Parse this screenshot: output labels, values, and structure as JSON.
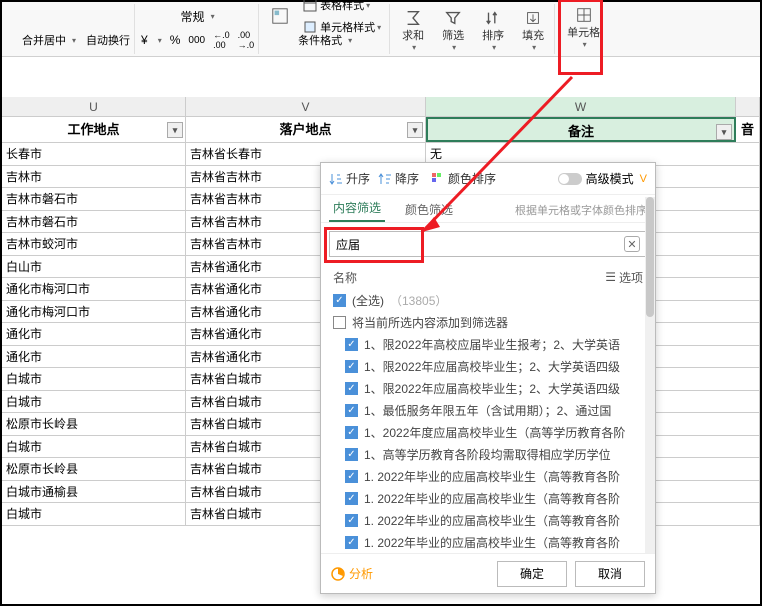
{
  "toolbar": {
    "merge_center": "合并居中",
    "wrap_text": "自动换行",
    "format_general": "常规",
    "currency": "¥",
    "percent": "%",
    "thousands": "000",
    "dec_inc": "←0.00",
    "dec_dec": ".00→0",
    "cond_format": "条件格式",
    "table_style": "表格样式",
    "cell_style": "单元格样式",
    "sum": "求和",
    "filter": "筛选",
    "sort": "排序",
    "fill": "填充",
    "cell": "单元格"
  },
  "columns": {
    "u": "U",
    "v": "V",
    "w": "W"
  },
  "headers": {
    "u": "工作地点",
    "v": "落户地点",
    "w": "备注",
    "end": "音"
  },
  "last_col_value": "无",
  "rows": [
    {
      "u": "长春市",
      "v": "吉林省长春市"
    },
    {
      "u": "吉林市",
      "v": "吉林省吉林市"
    },
    {
      "u": "吉林市磐石市",
      "v": "吉林省吉林市"
    },
    {
      "u": "吉林市磐石市",
      "v": "吉林省吉林市"
    },
    {
      "u": "吉林市蛟河市",
      "v": "吉林省吉林市"
    },
    {
      "u": "白山市",
      "v": "吉林省通化市"
    },
    {
      "u": "通化市梅河口市",
      "v": "吉林省通化市"
    },
    {
      "u": "通化市梅河口市",
      "v": "吉林省通化市"
    },
    {
      "u": "通化市",
      "v": "吉林省通化市"
    },
    {
      "u": "通化市",
      "v": "吉林省通化市"
    },
    {
      "u": "白城市",
      "v": "吉林省白城市"
    },
    {
      "u": "白城市",
      "v": "吉林省白城市"
    },
    {
      "u": "松原市长岭县",
      "v": "吉林省白城市"
    },
    {
      "u": "白城市",
      "v": "吉林省白城市"
    },
    {
      "u": "松原市长岭县",
      "v": "吉林省白城市"
    },
    {
      "u": "白城市通榆县",
      "v": "吉林省白城市"
    },
    {
      "u": "白城市",
      "v": "吉林省白城市"
    }
  ],
  "filter_panel": {
    "asc": "升序",
    "desc": "降序",
    "color_sort": "颜色排序",
    "adv_mode": "高级模式",
    "tab_content": "内容筛选",
    "tab_color": "颜色筛选",
    "hint": "根据单元格或字体颜色排序",
    "search_value": "应届",
    "name_label": "名称",
    "options": "选项",
    "select_all": "(全选)",
    "select_all_count": "（13805）",
    "add_current": "将当前所选内容添加到筛选器",
    "items": [
      "1、限2022年高校应届毕业生报考；2、大学英语",
      "1、限2022年应届高校毕业生；2、大学英语四级",
      "1、限2022年应届高校毕业生；2、大学英语四级",
      "1、最低服务年限五年（含试用期）；2、通过国",
      "1、2022年度应届高校毕业生（高等学历教育各阶",
      "1、高等学历教育各阶段均需取得相应学历学位",
      "1. 2022年毕业的应届高校毕业生（高等教育各阶",
      "1. 2022年毕业的应届高校毕业生（高等教育各阶",
      "1. 2022年毕业的应届高校毕业生（高等教育各阶",
      "1. 2022年毕业的应届高校毕业生（高等教育各阶"
    ],
    "analyze": "分析",
    "ok": "确定",
    "cancel": "取消"
  }
}
